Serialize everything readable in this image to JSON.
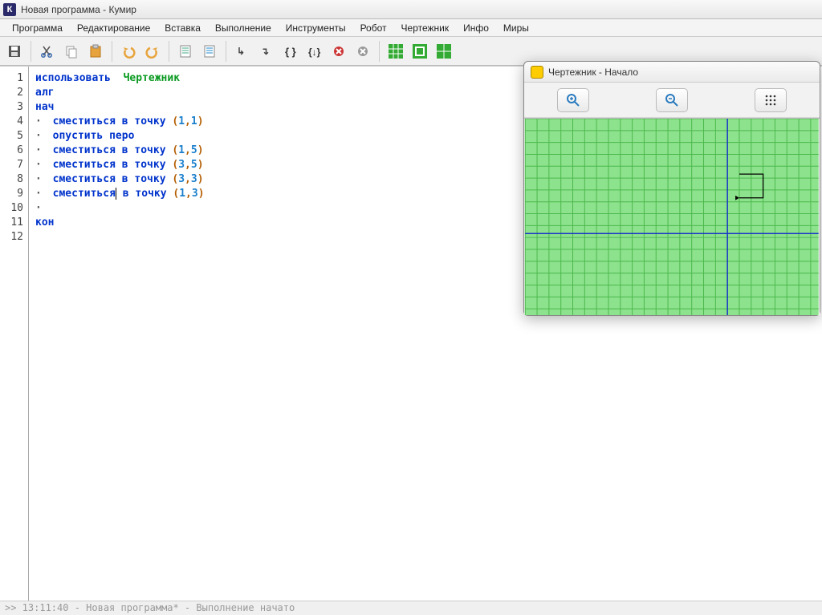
{
  "window": {
    "title": "Новая программа - Кумир"
  },
  "menu": {
    "items": [
      "Программа",
      "Редактирование",
      "Вставка",
      "Выполнение",
      "Инструменты",
      "Робот",
      "Чертежник",
      "Инфо",
      "Миры"
    ]
  },
  "toolbar": {
    "icons": [
      "save",
      "cut",
      "copy",
      "paste",
      "undo",
      "redo",
      "find",
      "replace",
      "step-into",
      "step-over",
      "brace-open",
      "brace-close",
      "stop",
      "cancel",
      "grid1",
      "grid2",
      "grid3"
    ]
  },
  "code": {
    "lines": [
      {
        "n": "1",
        "type": "use",
        "kw": "использовать",
        "arg": "Чертежник"
      },
      {
        "n": "2",
        "type": "kw",
        "kw": "алг"
      },
      {
        "n": "3",
        "type": "kw",
        "kw": "нач"
      },
      {
        "n": "4",
        "type": "cmd",
        "cmd": "сместиться в точку",
        "args": [
          "1",
          "1"
        ]
      },
      {
        "n": "5",
        "type": "cmd",
        "cmd": "опустить перо"
      },
      {
        "n": "6",
        "type": "cmd",
        "cmd": "сместиться в точку",
        "args": [
          "1",
          "5"
        ]
      },
      {
        "n": "7",
        "type": "cmd",
        "cmd": "сместиться в точку",
        "args": [
          "3",
          "5"
        ]
      },
      {
        "n": "8",
        "type": "cmd",
        "cmd": "сместиться в точку",
        "args": [
          "3",
          "3"
        ]
      },
      {
        "n": "9",
        "type": "cmd",
        "cmd": "сместиться в точку",
        "args": [
          "1",
          "3"
        ],
        "caret": true
      },
      {
        "n": "10",
        "type": "dot"
      },
      {
        "n": "11",
        "type": "kw",
        "kw": "кон"
      },
      {
        "n": "12",
        "type": "empty"
      }
    ]
  },
  "status": {
    "text": ">> 13:11:40 - Новая программа* - Выполнение начато"
  },
  "drawer": {
    "title": "Чертежник - Начало",
    "buttons": [
      "zoom-in",
      "zoom-out",
      "grid"
    ]
  }
}
